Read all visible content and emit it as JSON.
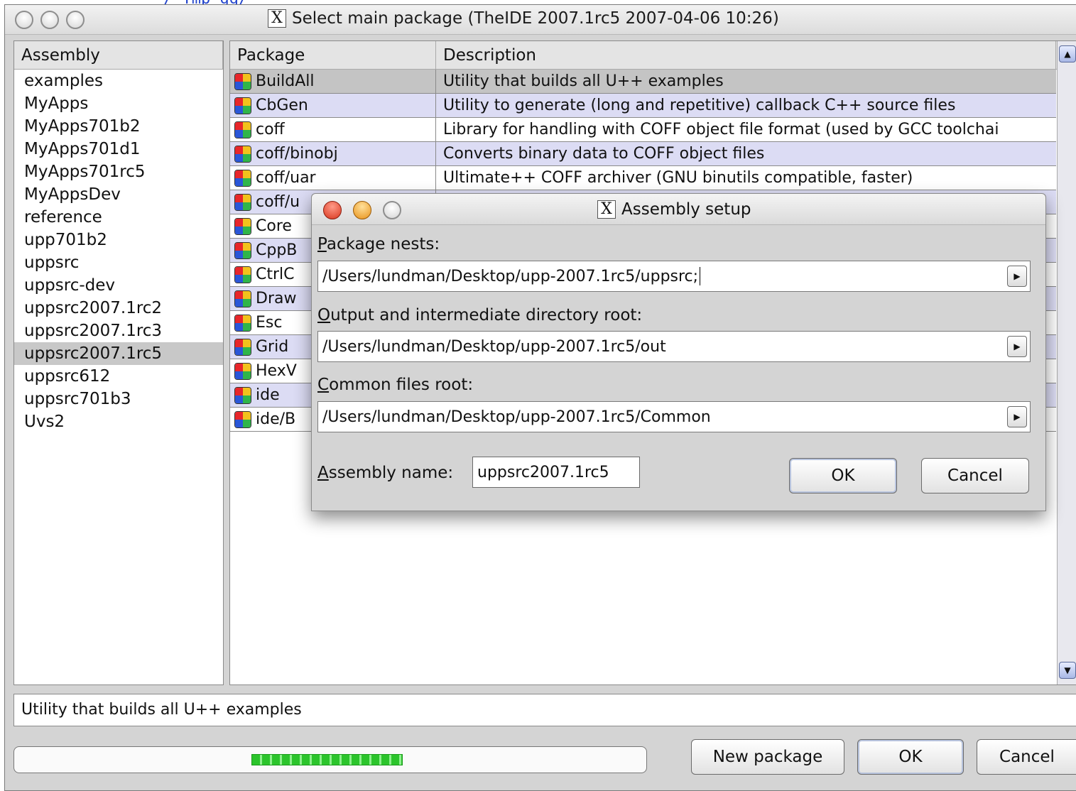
{
  "window": {
    "title": "Select main package (TheIDE 2007.1rc5 2007-04-06 10:26)"
  },
  "top_strip_text": "/ Tmp gg/",
  "assemblies": {
    "header": "Assembly",
    "items": [
      "examples",
      "MyApps",
      "MyApps701b2",
      "MyApps701d1",
      "MyApps701rc5",
      "MyAppsDev",
      "reference",
      "upp701b2",
      "uppsrc",
      "uppsrc-dev",
      "uppsrc2007.1rc2",
      "uppsrc2007.1rc3",
      "uppsrc2007.1rc5",
      "uppsrc612",
      "uppsrc701b3",
      "Uvs2"
    ],
    "selected": "uppsrc2007.1rc5"
  },
  "packages": {
    "headers": {
      "package": "Package",
      "description": "Description"
    },
    "rows": [
      {
        "name": "BuildAll",
        "desc": "Utility that builds all U++ examples"
      },
      {
        "name": "CbGen",
        "desc": "Utility to generate (long and repetitive) callback C++ source files"
      },
      {
        "name": "coff",
        "desc": "Library for handling with COFF object file format (used by GCC toolchai"
      },
      {
        "name": "coff/binobj",
        "desc": "Converts binary data to COFF object files"
      },
      {
        "name": "coff/uar",
        "desc": "Ultimate++ COFF archiver (GNU binutils compatible, faster)"
      },
      {
        "name": "coff/u",
        "desc": ""
      },
      {
        "name": "Core",
        "desc": ""
      },
      {
        "name": "CppB",
        "desc": ""
      },
      {
        "name": "CtrlC",
        "desc": ""
      },
      {
        "name": "Draw",
        "desc": ""
      },
      {
        "name": "Esc",
        "desc": ""
      },
      {
        "name": "Grid",
        "desc": ""
      },
      {
        "name": "HexV",
        "desc": ""
      },
      {
        "name": "ide",
        "desc": ""
      },
      {
        "name": "ide/B",
        "desc": ""
      }
    ]
  },
  "status_text": "Utility that builds all U++ examples",
  "progress": {
    "fraction": 0.24
  },
  "buttons": {
    "new_package": "New package",
    "ok": "OK",
    "cancel": "Cancel"
  },
  "dialog": {
    "title": "Assembly setup",
    "package_nests": {
      "mnemonic": "P",
      "rest": "ackage nests:",
      "value": "/Users/lundman/Desktop/upp-2007.1rc5/uppsrc;"
    },
    "output_root": {
      "mnemonic": "O",
      "rest": "utput and intermediate directory root:",
      "value": "/Users/lundman/Desktop/upp-2007.1rc5/out"
    },
    "common_root": {
      "mnemonic": "C",
      "rest": "ommon files root:",
      "value": "/Users/lundman/Desktop/upp-2007.1rc5/Common"
    },
    "assembly_name": {
      "mnemonic": "A",
      "rest": "ssembly name:",
      "value": "uppsrc2007.1rc5"
    },
    "ok": "OK",
    "cancel": "Cancel"
  },
  "colors": {
    "row_alt": "#dcdcf4",
    "row_selected": "#c4c4c4",
    "progress": "#2bc42b",
    "close_red": "#e0442c",
    "min_orange": "#f0a020"
  }
}
